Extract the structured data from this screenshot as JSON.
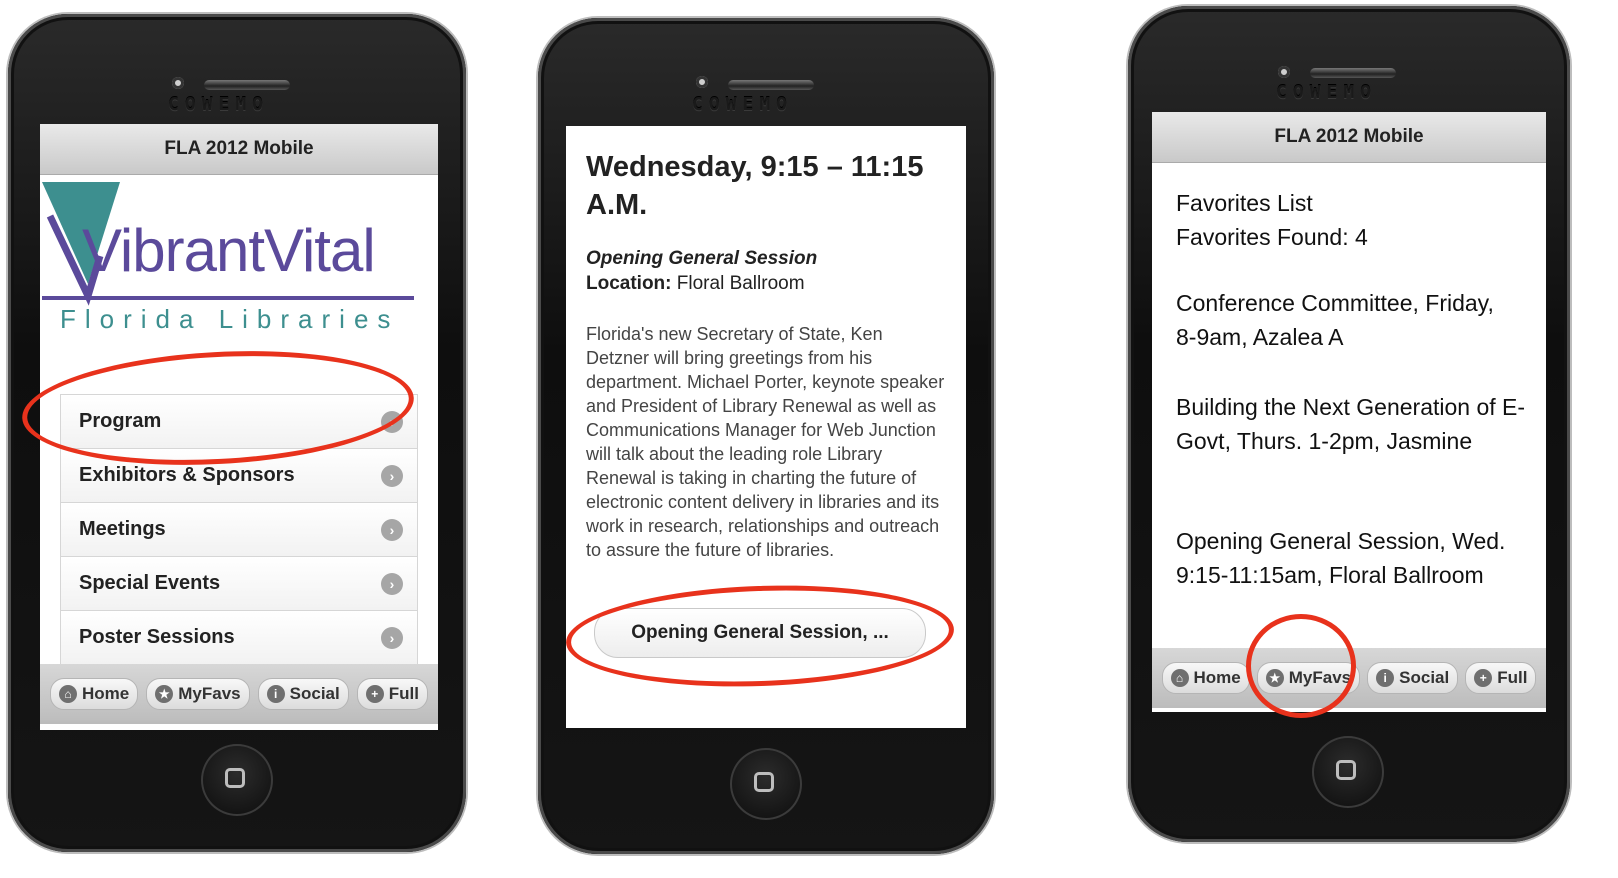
{
  "phone1": {
    "brand": "COWEMO",
    "header_title": "FLA 2012 Mobile",
    "logo": {
      "line1": "VibrantVital",
      "line2": "Florida Libraries"
    },
    "menu": [
      {
        "label": "Program"
      },
      {
        "label": "Exhibitors & Sponsors"
      },
      {
        "label": "Meetings"
      },
      {
        "label": "Special Events"
      },
      {
        "label": "Poster Sessions"
      }
    ],
    "footer": [
      "Home",
      "MyFavs",
      "Social",
      "Full"
    ]
  },
  "phone2": {
    "brand": "COWEMO",
    "title": "Wednesday, 9:15 – 11:15 A.M.",
    "session_name": "Opening General Session",
    "location_label": "Location:",
    "location_value": "Floral Ballroom",
    "body": "Florida's new Secretary of State, Ken Detzner will bring greetings from his department. Michael Porter, keynote speaker and President of Library Renewal as well as Communications Manager for Web Junction will talk about the leading role Library Renewal is taking in charting the future of electronic content delivery in libraries and its work in research, relationships and outreach to assure the future of libraries.",
    "button_label": "Opening General Session, ..."
  },
  "phone3": {
    "brand": "COWEMO",
    "header_title": "FLA 2012 Mobile",
    "list_title": "Favorites List",
    "found": "Favorites Found: 4",
    "items": [
      "Conference Committee, Friday, 8-9am, Azalea A",
      "Building the Next Generation of E-Govt, Thurs. 1-2pm, Jasmine",
      "Opening General Session, Wed. 9:15-11:15am, Floral Ballroom"
    ],
    "footer": [
      "Home",
      "MyFavs",
      "Social",
      "Full"
    ]
  },
  "colors": {
    "highlight": "#e8321c",
    "logo_teal": "#3d8f8f",
    "logo_purple": "#5b4a9b"
  }
}
